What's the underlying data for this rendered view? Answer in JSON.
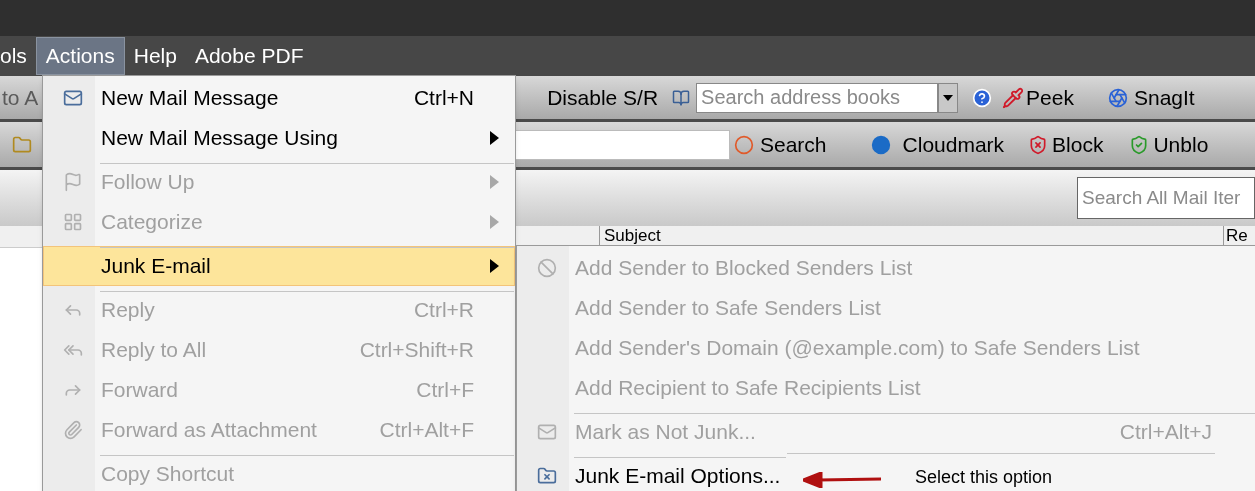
{
  "menu_bar": [
    {
      "label": "ols",
      "selected": false
    },
    {
      "label": "Actions",
      "selected": true
    },
    {
      "label": "Help",
      "selected": false
    },
    {
      "label": "Adobe PDF",
      "selected": false
    }
  ],
  "toolbar_1": {
    "cut_label": "to A",
    "disable_button": "Disable S/R",
    "address_search": {
      "placeholder": "Search address books"
    },
    "peek_button": "Peek",
    "snagit_button": "SnagIt"
  },
  "toolbar_2": {
    "search_button": "Search",
    "cloudmark_button": "Cloudmark",
    "block_button": "Block",
    "unblock_button": "Unblo"
  },
  "mail_search": {
    "placeholder": "Search All Mail Iter"
  },
  "columns": [
    "Subject",
    "Re"
  ],
  "actions_menu": [
    {
      "label": "New Mail Message",
      "shortcut": "Ctrl+N",
      "submenu": false,
      "disabled": false,
      "selected": false,
      "separator_before": false
    },
    {
      "label": "New Mail Message Using",
      "submenu": true,
      "disabled": false,
      "selected": false,
      "separator_before": false
    },
    {
      "label": "Follow Up",
      "submenu": true,
      "disabled": true,
      "selected": false,
      "separator_before": true
    },
    {
      "label": "Categorize",
      "submenu": true,
      "disabled": true,
      "selected": false,
      "separator_before": false
    },
    {
      "label": "Junk E-mail",
      "submenu": true,
      "disabled": false,
      "selected": true,
      "separator_before": true
    },
    {
      "label": "Reply",
      "shortcut": "Ctrl+R",
      "submenu": false,
      "disabled": true,
      "selected": false,
      "separator_before": true
    },
    {
      "label": "Reply to All",
      "shortcut": "Ctrl+Shift+R",
      "submenu": false,
      "disabled": true,
      "selected": false,
      "separator_before": false
    },
    {
      "label": "Forward",
      "shortcut": "Ctrl+F",
      "submenu": false,
      "disabled": true,
      "selected": false,
      "separator_before": false
    },
    {
      "label": "Forward as Attachment",
      "shortcut": "Ctrl+Alt+F",
      "submenu": false,
      "disabled": true,
      "selected": false,
      "separator_before": false
    },
    {
      "label": "Copy Shortcut",
      "submenu": false,
      "disabled": true,
      "selected": false,
      "separator_before": true
    }
  ],
  "junk_submenu": [
    {
      "label": "Add Sender to Blocked Senders List",
      "disabled": true,
      "separator_before": false
    },
    {
      "label": "Add Sender to Safe Senders List",
      "disabled": true,
      "separator_before": false
    },
    {
      "label": "Add Sender's Domain (@example.com) to Safe Senders List",
      "disabled": true,
      "separator_before": false
    },
    {
      "label": "Add Recipient to Safe Recipients List",
      "disabled": true,
      "separator_before": false
    },
    {
      "label": "Mark as Not Junk...",
      "shortcut": "Ctrl+Alt+J",
      "disabled": true,
      "separator_before": true
    },
    {
      "label": "Junk E-mail Options...",
      "disabled": false,
      "separator_before": true
    }
  ],
  "annotation": {
    "text": "Select this option"
  }
}
